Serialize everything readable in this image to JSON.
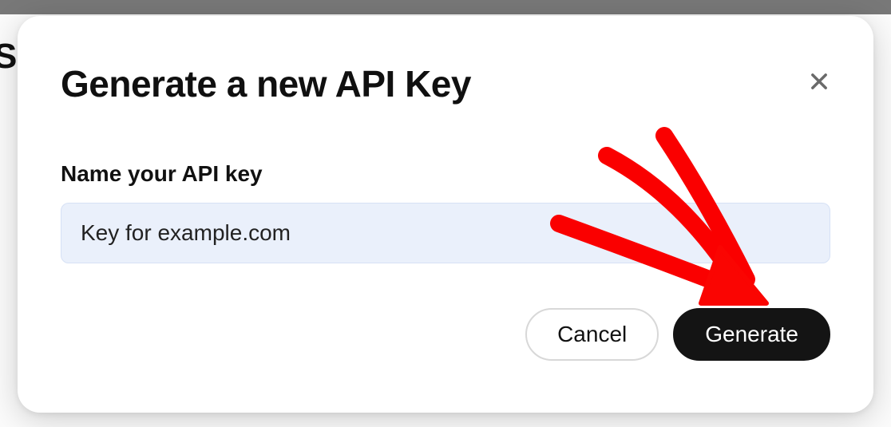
{
  "background": {
    "partial_text": "S"
  },
  "modal": {
    "title": "Generate a new API Key",
    "field_label": "Name your API key",
    "input_value": "Key for example.com",
    "buttons": {
      "cancel": "Cancel",
      "generate": "Generate"
    }
  }
}
